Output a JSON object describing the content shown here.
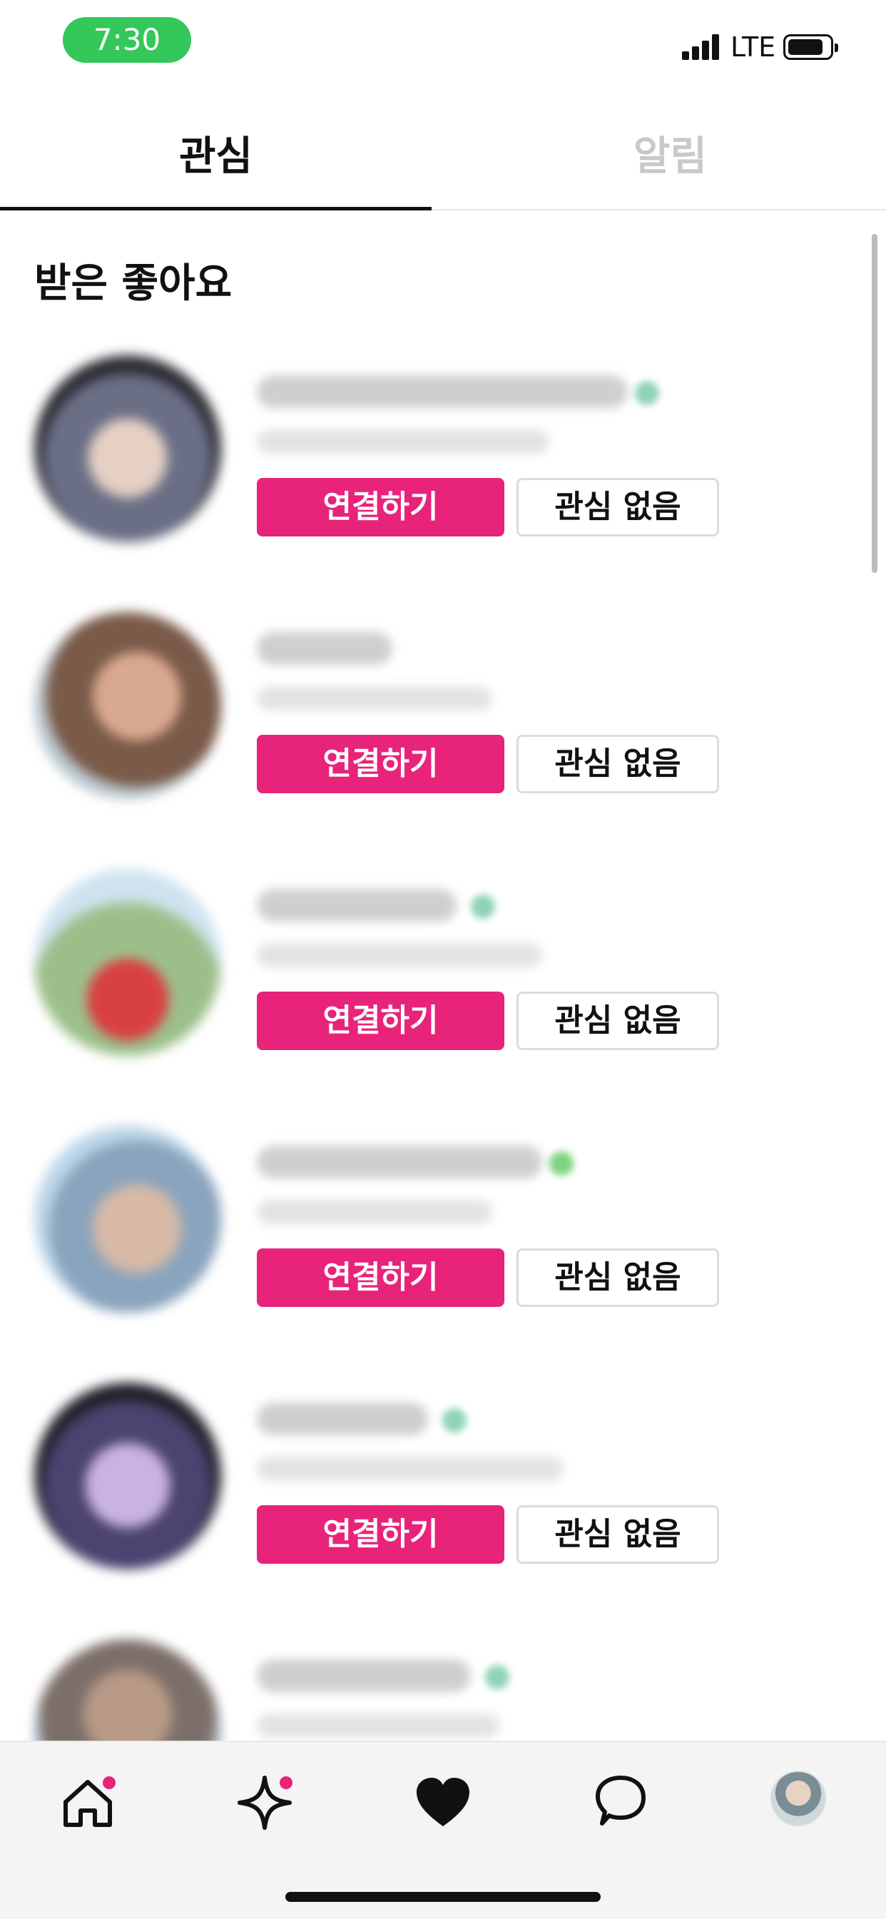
{
  "status_bar": {
    "time": "7:30",
    "network": "LTE"
  },
  "tabs": [
    {
      "label": "관심",
      "active": true
    },
    {
      "label": "알림",
      "active": false
    }
  ],
  "section_title": "받은 좋아요",
  "items": [
    {
      "connect_label": "연결하기",
      "pass_label": "관심 없음"
    },
    {
      "connect_label": "연결하기",
      "pass_label": "관심 없음"
    },
    {
      "connect_label": "연결하기",
      "pass_label": "관심 없음"
    },
    {
      "connect_label": "연결하기",
      "pass_label": "관심 없음"
    },
    {
      "connect_label": "연결하기",
      "pass_label": "관심 없음"
    }
  ],
  "bottom_nav": [
    {
      "icon": "home-icon",
      "badge": true
    },
    {
      "icon": "sparkle-icon",
      "badge": true
    },
    {
      "icon": "heart-icon",
      "badge": false
    },
    {
      "icon": "chat-bubble-icon",
      "badge": false
    },
    {
      "icon": "profile-avatar",
      "badge": false
    }
  ],
  "colors": {
    "accent": "#e8237a",
    "status_pill": "#34c759"
  }
}
